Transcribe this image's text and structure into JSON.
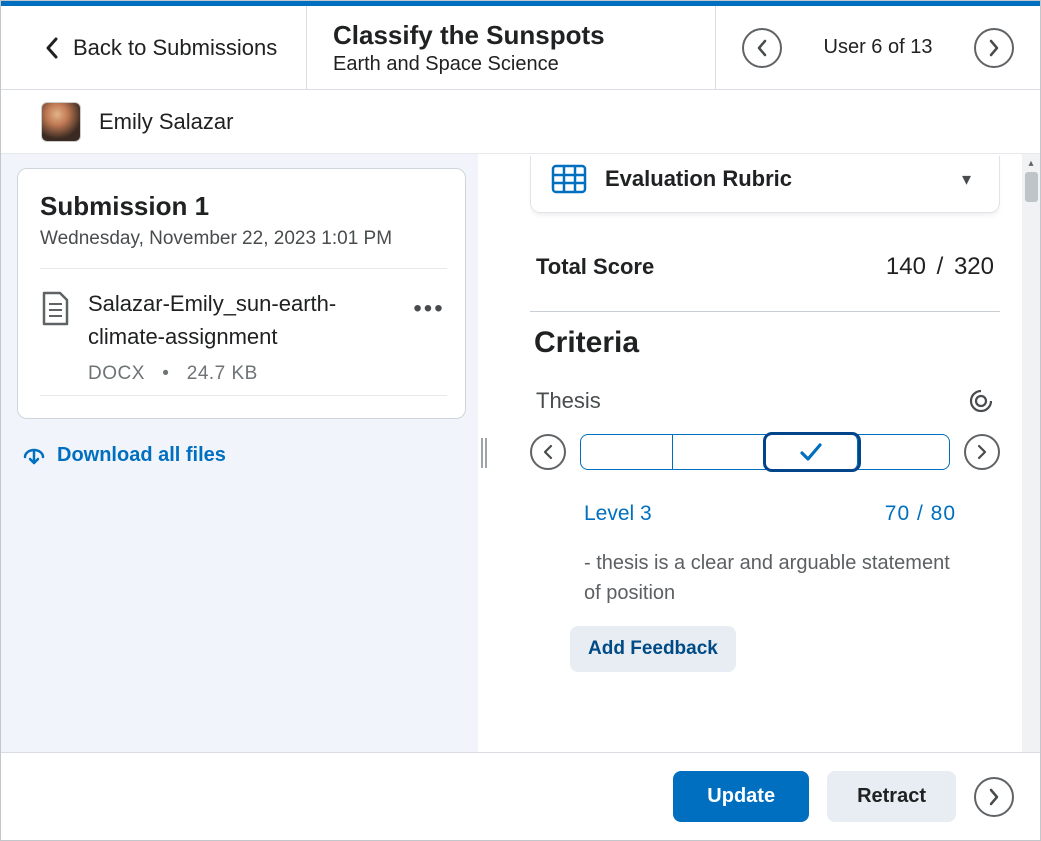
{
  "header": {
    "back_label": "Back to Submissions",
    "title": "Classify the Sunspots",
    "subtitle": "Earth and Space Science",
    "pager_label": "User 6 of 13"
  },
  "student": {
    "name": "Emily Salazar"
  },
  "submission": {
    "title": "Submission 1",
    "timestamp": "Wednesday, November 22, 2023 1:01 PM",
    "file": {
      "name": "Salazar-Emily_sun-earth-climate-assignment",
      "type": "DOCX",
      "bullet": "•",
      "size": "24.7 KB"
    },
    "download_label": "Download all files"
  },
  "rubric": {
    "header_label": "Evaluation Rubric",
    "total_score_label": "Total Score",
    "score": "140",
    "score_sep": " / ",
    "max_score": "320",
    "criteria_label": "Criteria",
    "criterion": {
      "name": "Thesis",
      "selected_level_name": "Level 3",
      "selected_level_score": "70",
      "selected_level_sep": " / ",
      "selected_level_max": "80",
      "description": "- thesis is a clear and arguable statement of position",
      "add_feedback_label": "Add Feedback"
    }
  },
  "footer": {
    "update_label": "Update",
    "retract_label": "Retract"
  }
}
